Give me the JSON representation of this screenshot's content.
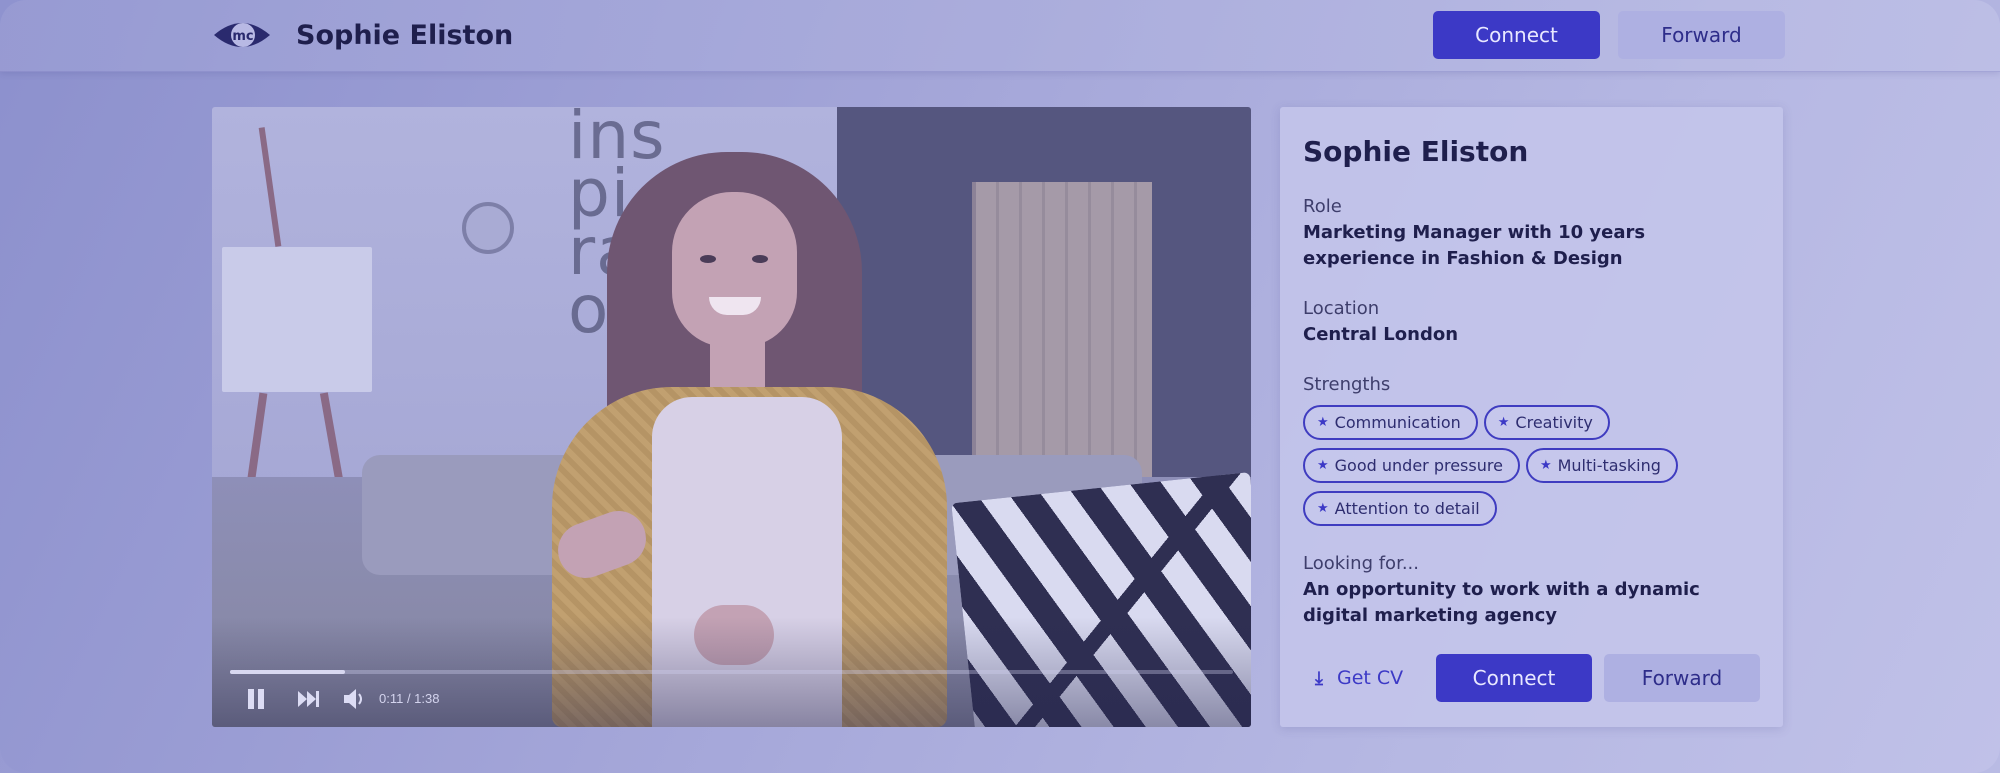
{
  "header": {
    "logo_icon": "eye-logo-icon",
    "logo_text": "mc",
    "name": "Sophie Eliston",
    "connect_label": "Connect",
    "forward_label": "Forward"
  },
  "video": {
    "wall_text": "ins\npi\nrati\non",
    "progress": 0.115,
    "time": "0:11 / 1:38",
    "controls": [
      "pause-icon",
      "next-icon",
      "volume-icon"
    ]
  },
  "profile": {
    "name": "Sophie Eliston",
    "role_label": "Role",
    "role": "Marketing Manager with 10 years experience in Fashion & Design",
    "location_label": "Location",
    "location": "Central London",
    "strengths_label": "Strengths",
    "strengths": [
      "Communication",
      "Creativity",
      "Good under pressure",
      "Multi-tasking",
      "Attention to detail"
    ],
    "looking_for_label": "Looking for...",
    "looking_for": "An opportunity to work with a dynamic digital marketing agency",
    "get_cv_label": "Get CV",
    "connect_label": "Connect",
    "forward_label": "Forward"
  },
  "colors": {
    "primary": "#3c39c6",
    "secondary_button": "#aeb0e2",
    "text_dark": "#1f1f4d"
  }
}
